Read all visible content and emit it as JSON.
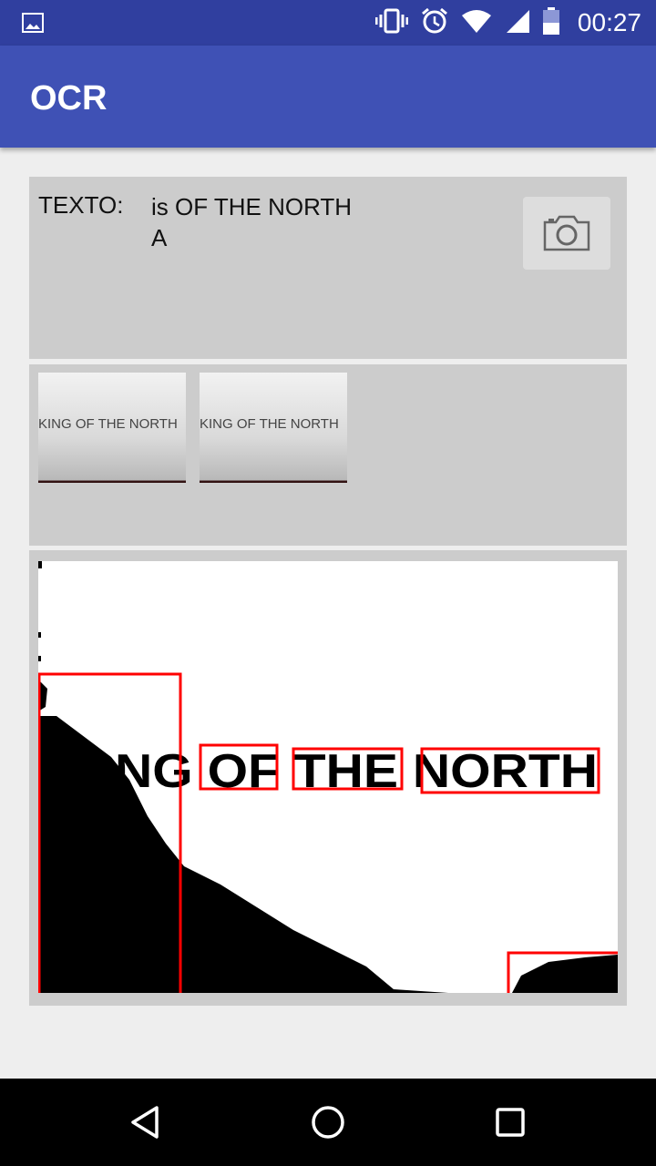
{
  "status_bar": {
    "time": "00:27",
    "icons": [
      "gallery-icon",
      "vibrate-icon",
      "alarm-icon",
      "wifi-icon",
      "signal-icon",
      "battery-icon"
    ]
  },
  "app_bar": {
    "title": "OCR"
  },
  "text_panel": {
    "label": "TEXTO:",
    "line1": "is OF THE NORTH",
    "line2": "A",
    "camera_icon": "camera-icon"
  },
  "thumbnails": [
    {
      "text": "KING OF THE NORTH"
    },
    {
      "text": "KING OF THE NORTH"
    }
  ],
  "result_image": {
    "visible_text": "NG OF THE NORTH",
    "box_color": "#ff0000"
  },
  "nav_bar": {
    "icons": [
      "back-icon",
      "home-icon",
      "recents-icon"
    ]
  },
  "colors": {
    "primary": "#3f51b5",
    "primary_dark": "#303f9f",
    "panel": "#cccccc",
    "background": "#eeeeee"
  }
}
